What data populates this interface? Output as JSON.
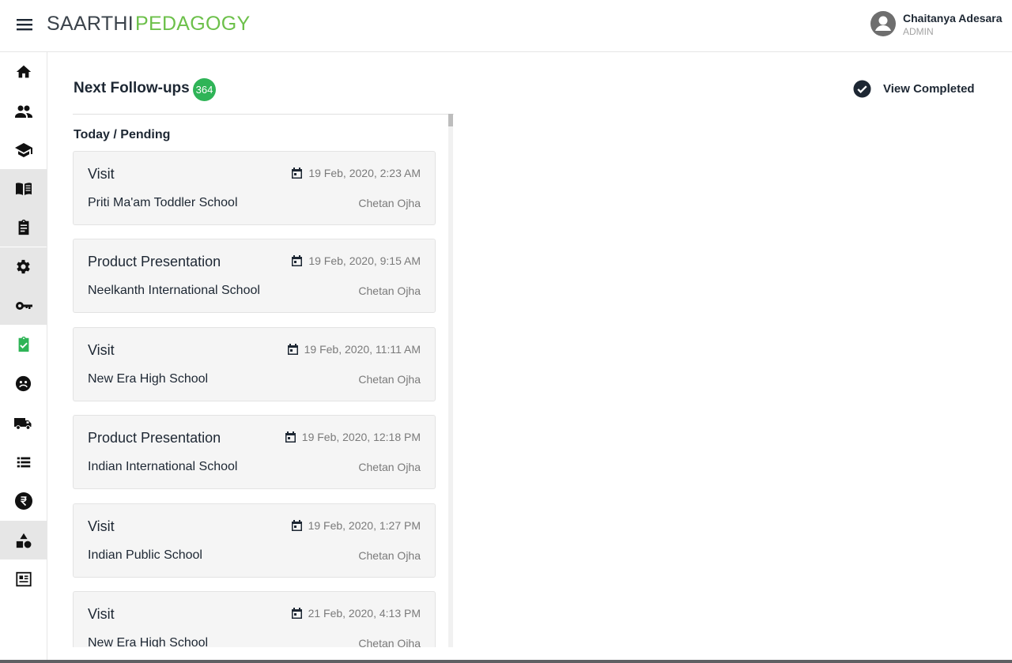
{
  "header": {
    "logo_part1": "SAARTHI",
    "logo_part2": "PEDAGOGY",
    "user_name": "Chaitanya Adesara",
    "user_role": "ADMIN"
  },
  "sidebar": {
    "items": [
      {
        "icon": "home-icon"
      },
      {
        "icon": "people-icon"
      },
      {
        "icon": "graduation-cap-icon"
      },
      {
        "icon": "book-icon"
      },
      {
        "icon": "clipboard-icon"
      },
      {
        "icon": "gear-icon"
      },
      {
        "icon": "key-icon"
      },
      {
        "icon": "assignment-check-icon",
        "active": true
      },
      {
        "icon": "face-icon"
      },
      {
        "icon": "truck-icon"
      },
      {
        "icon": "list-icon"
      },
      {
        "icon": "rupee-icon"
      },
      {
        "icon": "category-shapes-icon"
      },
      {
        "icon": "newspaper-icon"
      }
    ]
  },
  "main": {
    "title": "Next Follow-ups",
    "count": "364",
    "view_completed_label": "View Completed",
    "section_label": "Today / Pending",
    "followups": [
      {
        "type": "Visit",
        "date": "19 Feb, 2020, 2:23 AM",
        "school": "Priti Ma'am Toddler School",
        "person": "Chetan Ojha"
      },
      {
        "type": "Product Presentation",
        "date": "19 Feb, 2020, 9:15 AM",
        "school": "Neelkanth International School",
        "person": "Chetan Ojha"
      },
      {
        "type": "Visit",
        "date": "19 Feb, 2020, 11:11 AM",
        "school": "New Era High School",
        "person": "Chetan Ojha"
      },
      {
        "type": "Product Presentation",
        "date": "19 Feb, 2020, 12:18 PM",
        "school": "Indian International School",
        "person": "Chetan Ojha"
      },
      {
        "type": "Visit",
        "date": "19 Feb, 2020, 1:27 PM",
        "school": "Indian Public School",
        "person": "Chetan Ojha"
      },
      {
        "type": "Visit",
        "date": "21 Feb, 2020, 4:13 PM",
        "school": "New Era High School",
        "person": "Chetan Ojha"
      }
    ]
  },
  "colors": {
    "brand_dark": "#3b434b",
    "brand_green": "#6cc04a",
    "badge_green": "#2fb457",
    "active_icon": "#2fb457",
    "text_primary": "#1d2733",
    "text_muted": "#7a7a7a"
  }
}
